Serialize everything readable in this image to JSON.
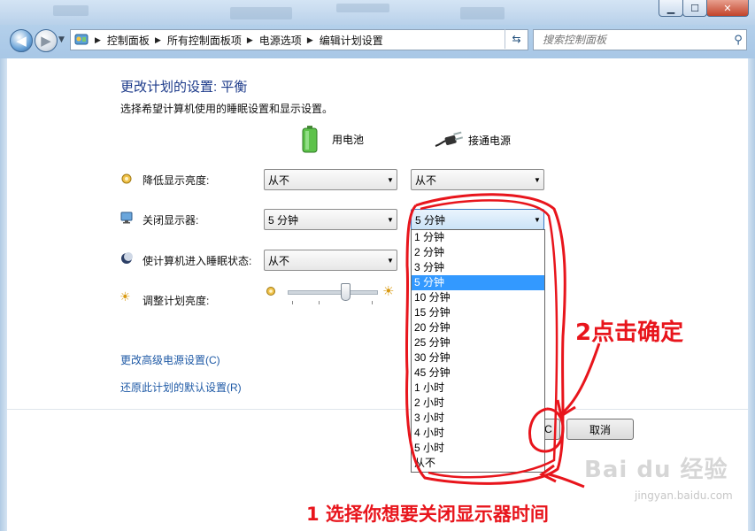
{
  "window": {
    "minimize_glyph": "▁",
    "maximize_glyph": "☐",
    "close_glyph": "✕"
  },
  "nav": {
    "back_glyph": "◀",
    "forward_glyph": "▶",
    "dropdown_glyph": "▼",
    "refresh_glyph": "⇆"
  },
  "breadcrumb": [
    "控制面板",
    "所有控制面板项",
    "电源选项",
    "编辑计划设置"
  ],
  "search": {
    "placeholder": "搜索控制面板",
    "icon": "search-icon"
  },
  "page": {
    "title": "更改计划的设置: 平衡",
    "subtitle": "选择希望计算机使用的睡眠设置和显示设置。"
  },
  "columns": {
    "battery": {
      "label": "用电池",
      "icon": "battery-icon"
    },
    "plugged": {
      "label": "接通电源",
      "icon": "power-plug-icon"
    }
  },
  "settings": [
    {
      "label": "降低显示亮度:",
      "icon": "dim-display-icon",
      "battery": "从不",
      "plugged": "从不"
    },
    {
      "label": "关闭显示器:",
      "icon": "monitor-icon",
      "battery": "5 分钟",
      "plugged": "5 分钟"
    },
    {
      "label": "使计算机进入睡眠状态:",
      "icon": "sleep-moon-icon",
      "battery": "从不"
    },
    {
      "label": "调整计划亮度:",
      "icon": "brightness-sun-icon",
      "brightness_level": 0.62
    }
  ],
  "dropdown": {
    "options": [
      "1 分钟",
      "2 分钟",
      "3 分钟",
      "5 分钟",
      "10 分钟",
      "15 分钟",
      "20 分钟",
      "25 分钟",
      "30 分钟",
      "45 分钟",
      "1 小时",
      "2 小时",
      "3 小时",
      "4 小时",
      "5 小时",
      "从不"
    ],
    "selected_index": 3
  },
  "links": {
    "advanced": "更改高级电源设置(C)",
    "restore": "还原此计划的默认设置(R)"
  },
  "buttons": {
    "save": "C",
    "cancel": "取消"
  },
  "annotations": {
    "step1": "1 选择你想要关闭显示器时间",
    "step2": "2点击确定",
    "color": "#e8151c"
  },
  "watermark": {
    "brand": "Bai du 经验",
    "url": "jingyan.baidu.com"
  }
}
